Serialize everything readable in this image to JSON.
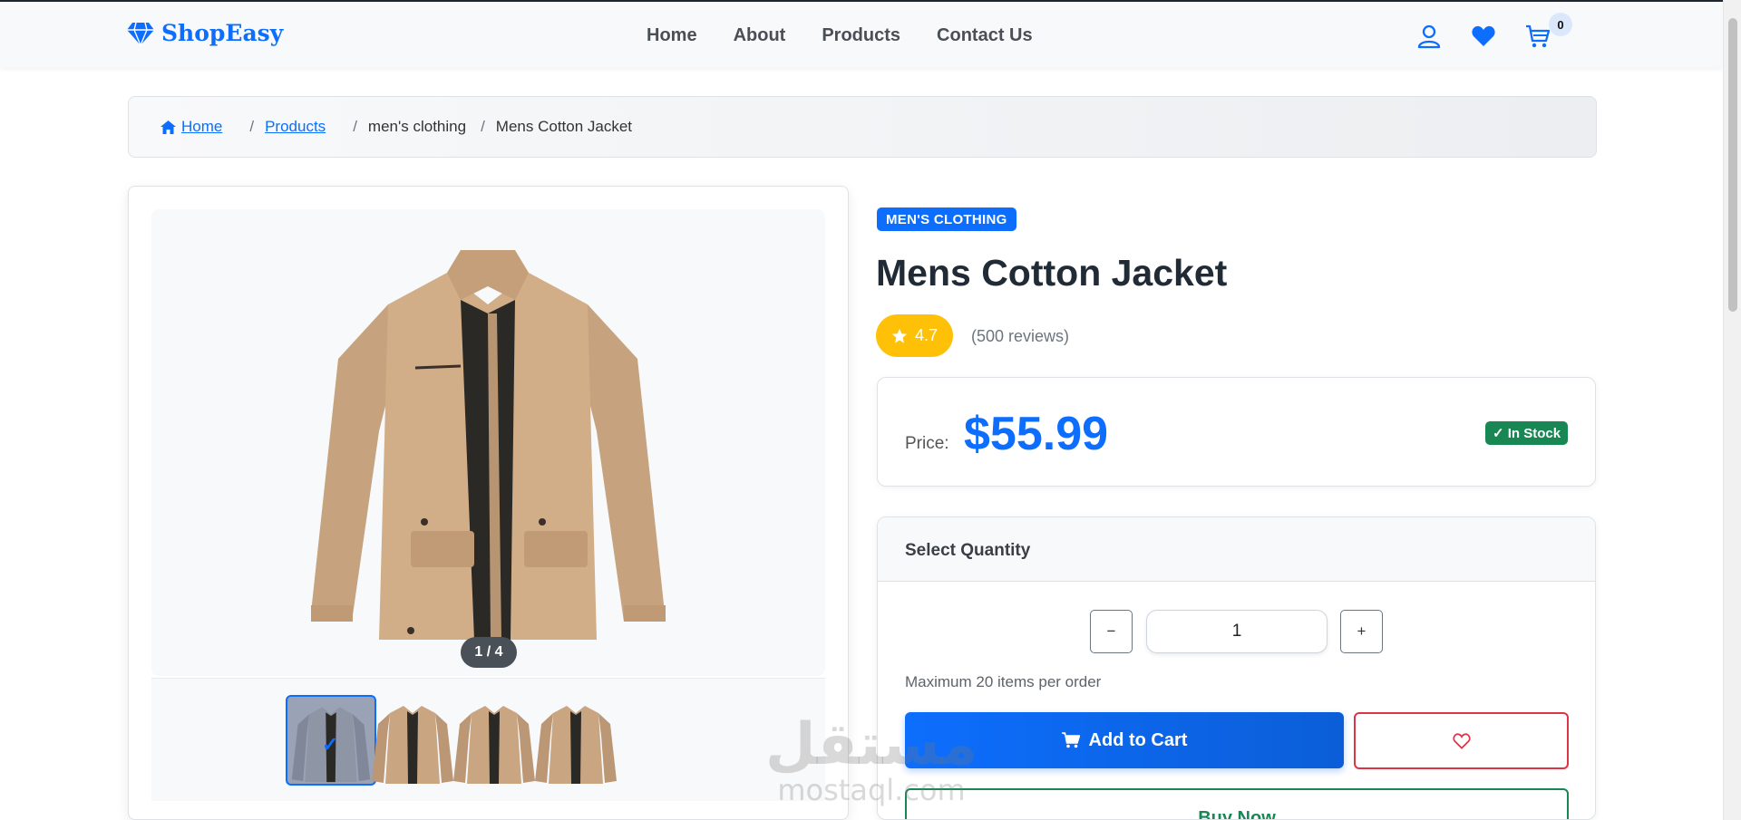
{
  "navbar": {
    "brand": "ShopEasy",
    "links": [
      "Home",
      "About",
      "Products",
      "Contact Us"
    ],
    "icons": [
      "user-icon",
      "heart-icon",
      "cart-icon"
    ],
    "cart_count": "0"
  },
  "breadcrumb": {
    "home": "Home",
    "products": "Products",
    "category": "men's clothing",
    "current": "Mens Cotton Jacket",
    "separator": "/"
  },
  "gallery": {
    "counter": "1 / 4",
    "thumbnail_count": 4
  },
  "product": {
    "category": "MEN'S CLOTHING",
    "title": "Mens Cotton Jacket",
    "rating": "4.7",
    "reviews": "(500 reviews)",
    "price_label": "Price:",
    "price": "$55.99",
    "stock": "✓ In Stock"
  },
  "quantity": {
    "header": "Select Quantity",
    "minus": "−",
    "plus": "+",
    "value": "1",
    "note": "Maximum 20 items per order"
  },
  "actions": {
    "add_to_cart": "Add to Cart",
    "buy_now": "Buy Now"
  },
  "watermark": {
    "arabic": "مستقل",
    "latin": "mostaql.com"
  },
  "colors": {
    "primary": "#0d6efd",
    "success": "#198754",
    "warning": "#ffc107",
    "danger": "#dc3545"
  }
}
